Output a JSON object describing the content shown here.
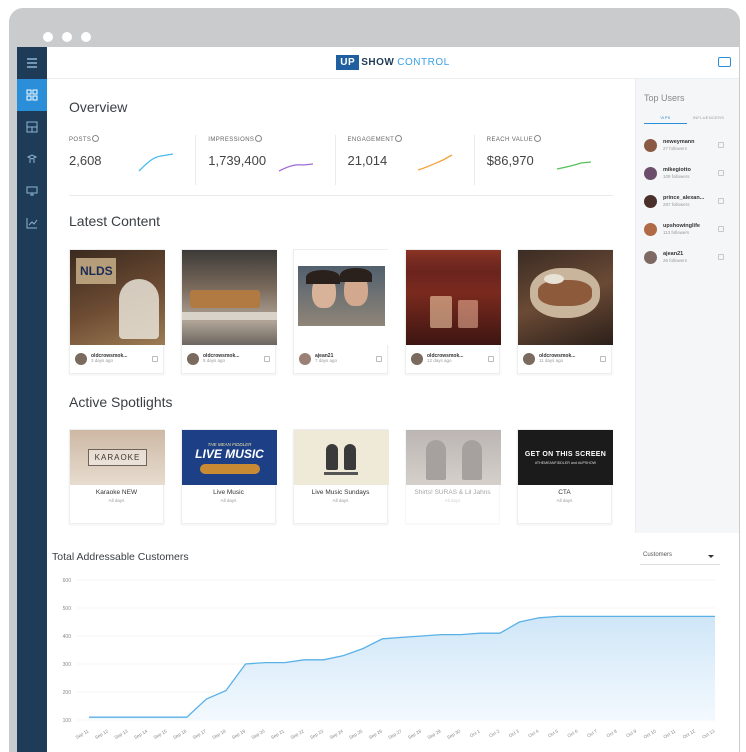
{
  "app": {
    "logo_up": "UP",
    "logo_show": "SHOW",
    "logo_control": "CONTROL"
  },
  "nav": {
    "items": [
      {
        "icon": "menu-icon"
      },
      {
        "icon": "dashboard-icon",
        "active": true
      },
      {
        "icon": "content-icon"
      },
      {
        "icon": "spotlight-icon"
      },
      {
        "icon": "display-icon"
      },
      {
        "icon": "analytics-icon"
      }
    ]
  },
  "overview": {
    "title": "Overview",
    "stats": [
      {
        "label": "POSTS",
        "value": "2,608",
        "color": "#49b9f0"
      },
      {
        "label": "IMPRESSIONS",
        "value": "1,739,400",
        "color": "#a06bd8"
      },
      {
        "label": "ENGAGEMENT",
        "value": "21,014",
        "color": "#f4a23a"
      },
      {
        "label": "REACH VALUE",
        "value": "$86,970",
        "color": "#55c25a"
      }
    ]
  },
  "latest": {
    "title": "Latest Content",
    "cards": [
      {
        "user": "oldcrowsmok...",
        "time": "3 days ago",
        "scene": "baseball"
      },
      {
        "user": "oldcrowsmok...",
        "time": "5 days ago",
        "scene": "kitchen"
      },
      {
        "user": "ajean21",
        "time": "7 days ago",
        "scene": "selfie"
      },
      {
        "user": "oldcrowsmok...",
        "time": "12 days ago",
        "scene": "drinks"
      },
      {
        "user": "oldcrowsmok...",
        "time": "11 days ago",
        "scene": "food"
      }
    ]
  },
  "spotlights": {
    "title": "Active Spotlights",
    "items": [
      {
        "title": "Karaoke NEW",
        "sub": "All days",
        "poster": "KARAOKE"
      },
      {
        "title": "Live Music",
        "sub": "All days",
        "poster_top": "THE MEAN FIDDLER",
        "poster": "LIVE MUSIC"
      },
      {
        "title": "Live Music Sundays",
        "sub": "All days"
      },
      {
        "title": "Shirts! SURAS & Lil Jahns",
        "sub": "All days",
        "faded": true
      },
      {
        "title": "CTA",
        "sub": "All days",
        "poster": "GET ON THIS SCREEN",
        "poster_sub": "#THEMEANFIDDLER and #UPSHOW"
      }
    ]
  },
  "top_users": {
    "title": "Top Users",
    "tabs": [
      "VIPS",
      "INFLUENCERS"
    ],
    "users": [
      {
        "name": "neweymann",
        "sub": "27 followers"
      },
      {
        "name": "mikegiotto",
        "sub": "109 followers"
      },
      {
        "name": "prince_alexan...",
        "sub": "287 followers"
      },
      {
        "name": "upshowinglife",
        "sub": "113 followers"
      },
      {
        "name": "ajean21",
        "sub": "26 followers"
      }
    ]
  },
  "tac": {
    "title": "Total Addressable Customers",
    "dropdown": "Customers"
  },
  "chart_data": {
    "type": "area",
    "y_ticks": [
      "600",
      "500",
      "400",
      "300",
      "200",
      "100"
    ],
    "ylim": [
      100,
      600
    ],
    "categories": [
      "Sep 11",
      "Sep 12",
      "Sep 13",
      "Sep 14",
      "Sep 15",
      "Sep 16",
      "Sep 17",
      "Sep 18",
      "Sep 19",
      "Sep 20",
      "Sep 21",
      "Sep 22",
      "Sep 23",
      "Sep 24",
      "Sep 25",
      "Sep 26",
      "Sep 27",
      "Sep 28",
      "Sep 29",
      "Sep 30",
      "Oct 1",
      "Oct 2",
      "Oct 3",
      "Oct 4",
      "Oct 5",
      "Oct 6",
      "Oct 7",
      "Oct 8",
      "Oct 9",
      "Oct 10",
      "Oct 11",
      "Oct 12",
      "Oct 13"
    ],
    "values": [
      110,
      110,
      110,
      110,
      110,
      110,
      175,
      205,
      300,
      305,
      305,
      315,
      315,
      330,
      355,
      390,
      395,
      400,
      405,
      405,
      410,
      410,
      450,
      465,
      470,
      470,
      470,
      470,
      470,
      470,
      470,
      470,
      470
    ],
    "line_color": "#5ab1e6",
    "fill_color": "#cfe6f7"
  }
}
